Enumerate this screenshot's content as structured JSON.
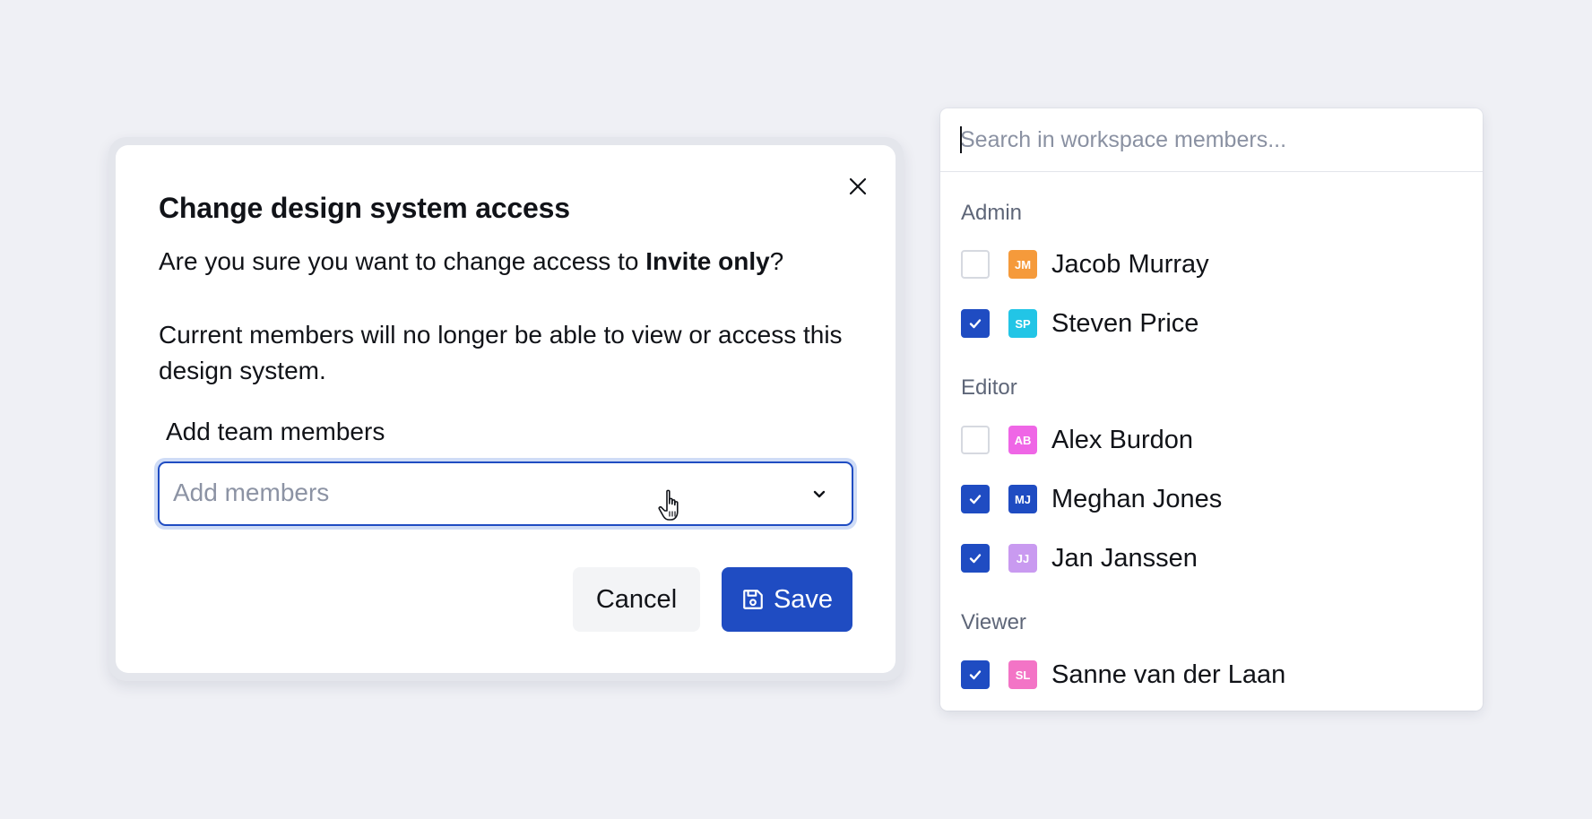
{
  "dialog": {
    "title": "Change design system access",
    "line1_prefix": "Are you sure you want to change access to ",
    "line1_bold": "Invite only",
    "line1_suffix": "?",
    "line2": "Current members will no longer be able to view or access this design system.",
    "field_label": "Add team members",
    "select_placeholder": "Add members",
    "cancel_label": "Cancel",
    "save_label": "Save",
    "icons": {
      "close": "close-icon",
      "chevron": "chevron-down-icon",
      "save": "floppy-disk-icon",
      "cursor": "hand-pointer-cursor"
    }
  },
  "panel": {
    "search_placeholder": "Search in workspace members...",
    "groups": [
      {
        "label": "Admin",
        "members": [
          {
            "name": "Jacob Murray",
            "initials": "JM",
            "color": "#f59a3b",
            "checked": false
          },
          {
            "name": "Steven Price",
            "initials": "SP",
            "color": "#22c5e6",
            "checked": true
          }
        ]
      },
      {
        "label": "Editor",
        "members": [
          {
            "name": "Alex Burdon",
            "initials": "AB",
            "color": "#ef66e6",
            "checked": false
          },
          {
            "name": "Meghan Jones",
            "initials": "MJ",
            "color": "#1f4cc2",
            "checked": true
          },
          {
            "name": "Jan Janssen",
            "initials": "JJ",
            "color": "#c99af0",
            "checked": true
          }
        ]
      },
      {
        "label": "Viewer",
        "members": [
          {
            "name": "Sanne van der Laan",
            "initials": "SL",
            "color": "#f374c6",
            "checked": true
          }
        ]
      }
    ]
  },
  "colors": {
    "accent": "#1f4cc2",
    "background": "#eff0f5",
    "muted_text": "#5e6678"
  }
}
